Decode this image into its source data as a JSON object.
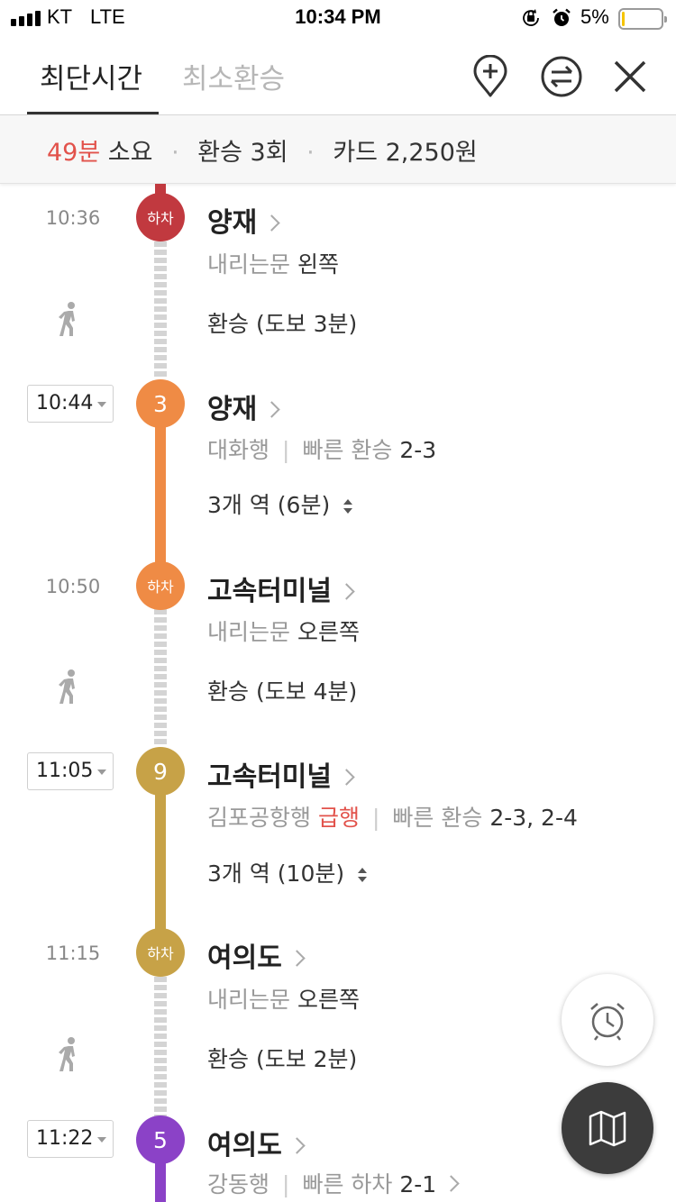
{
  "status_bar": {
    "carrier": "KT",
    "network": "LTE",
    "time": "10:34 PM",
    "battery_percent": "5%",
    "battery_level": 0.05,
    "icons": [
      "signal-bars-icon",
      "orientation-lock-icon",
      "alarm-icon",
      "battery-icon"
    ]
  },
  "header": {
    "tabs": [
      {
        "label": "최단시간",
        "active": true
      },
      {
        "label": "최소환승",
        "active": false
      }
    ],
    "actions": [
      "add-waypoint-icon",
      "swap-icon",
      "close-icon"
    ]
  },
  "summary": {
    "duration": "49분",
    "duration_suffix": "소요",
    "transfers": "환승 3회",
    "fare": "카드 2,250원"
  },
  "colors": {
    "accent_red": "#e2524b",
    "line_sinbundang": "#c1393f",
    "line_3": "#ef8b45",
    "line_9": "#c7a247",
    "line_5": "#8b42c7",
    "walk": "#d4d4d4"
  },
  "timeline": {
    "s1": {
      "time": "10:36",
      "badge": "하차",
      "station": "양재",
      "door_label": "내리는문",
      "door_side": "왼쪽"
    },
    "w1": {
      "text": "환승 (도보 3분)"
    },
    "s2": {
      "time": "10:44",
      "badge": "3",
      "station": "양재",
      "direction": "대화행",
      "fast_label": "빠른 환승",
      "fast_value": "2-3",
      "stops": "3개 역 (6분)"
    },
    "s3": {
      "time": "10:50",
      "badge": "하차",
      "station": "고속터미널",
      "door_label": "내리는문",
      "door_side": "오른쪽"
    },
    "w2": {
      "text": "환승 (도보 4분)"
    },
    "s4": {
      "time": "11:05",
      "badge": "9",
      "station": "고속터미널",
      "direction": "김포공항행",
      "express": "급행",
      "fast_label": "빠른 환승",
      "fast_value": "2-3, 2-4",
      "stops": "3개 역 (10분)"
    },
    "s5": {
      "time": "11:15",
      "badge": "하차",
      "station": "여의도",
      "door_label": "내리는문",
      "door_side": "오른쪽"
    },
    "w3": {
      "text": "환승 (도보 2분)"
    },
    "s6": {
      "time": "11:22",
      "badge": "5",
      "station": "여의도",
      "direction": "강동행",
      "fast_label": "빠른 하차",
      "fast_value": "2-1"
    }
  },
  "floating": {
    "alarm": "alarm-clock-icon",
    "map": "map-icon"
  }
}
